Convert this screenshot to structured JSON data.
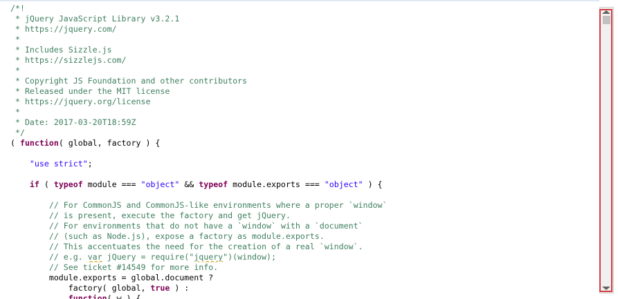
{
  "editor": {
    "lines": [
      [
        {
          "t": "/*!",
          "c": "cm"
        }
      ],
      [
        {
          "t": " * jQuery JavaScript Library v3.2.1",
          "c": "cm"
        }
      ],
      [
        {
          "t": " * https://jquery.com/",
          "c": "cm"
        }
      ],
      [
        {
          "t": " *",
          "c": "cm"
        }
      ],
      [
        {
          "t": " * Includes Sizzle.js",
          "c": "cm"
        }
      ],
      [
        {
          "t": " * https://sizzlejs.com/",
          "c": "cm"
        }
      ],
      [
        {
          "t": " *",
          "c": "cm"
        }
      ],
      [
        {
          "t": " * Copyright JS Foundation and other contributors",
          "c": "cm"
        }
      ],
      [
        {
          "t": " * Released under the MIT license",
          "c": "cm"
        }
      ],
      [
        {
          "t": " * https://jquery.org/license",
          "c": "cm"
        }
      ],
      [
        {
          "t": " *",
          "c": "cm"
        }
      ],
      [
        {
          "t": " * Date: 2017-03-20T18:59Z",
          "c": "cm"
        }
      ],
      [
        {
          "t": " */",
          "c": "cm"
        }
      ],
      [
        {
          "t": "( ",
          "c": "pl"
        },
        {
          "t": "function",
          "c": "kw"
        },
        {
          "t": "( global, factory ) {",
          "c": "pl"
        }
      ],
      [],
      [
        {
          "t": "    ",
          "c": "pl"
        },
        {
          "t": "\"use strict\"",
          "c": "st"
        },
        {
          "t": ";",
          "c": "pl"
        }
      ],
      [],
      [
        {
          "t": "    ",
          "c": "pl"
        },
        {
          "t": "if",
          "c": "kw"
        },
        {
          "t": " ( ",
          "c": "pl"
        },
        {
          "t": "typeof",
          "c": "kw"
        },
        {
          "t": " module === ",
          "c": "pl"
        },
        {
          "t": "\"object\"",
          "c": "st"
        },
        {
          "t": " && ",
          "c": "pl"
        },
        {
          "t": "typeof",
          "c": "kw"
        },
        {
          "t": " module.exports === ",
          "c": "pl"
        },
        {
          "t": "\"object\"",
          "c": "st"
        },
        {
          "t": " ) {",
          "c": "pl"
        }
      ],
      [],
      [
        {
          "t": "        // For CommonJS and CommonJS-like environments where a proper `window`",
          "c": "cm"
        }
      ],
      [
        {
          "t": "        // is present, execute the factory and get jQuery.",
          "c": "cm"
        }
      ],
      [
        {
          "t": "        // For environments that do not have a `window` with a `document`",
          "c": "cm"
        }
      ],
      [
        {
          "t": "        // (such as Node.js), expose a factory as module.exports.",
          "c": "cm"
        }
      ],
      [
        {
          "t": "        // This accentuates the need for the creation of a real `window`.",
          "c": "cm"
        }
      ],
      [
        {
          "t": "        // e.g. ",
          "c": "cm"
        },
        {
          "t": "var",
          "c": "cm sq"
        },
        {
          "t": " jQuery = require(\"",
          "c": "cm"
        },
        {
          "t": "jquery",
          "c": "cm sq"
        },
        {
          "t": "\")(window);",
          "c": "cm"
        }
      ],
      [
        {
          "t": "        // See ticket #14549 for more info.",
          "c": "cm"
        }
      ],
      [
        {
          "t": "        module.exports = global.document ?",
          "c": "pl"
        }
      ],
      [
        {
          "t": "            factory( global, ",
          "c": "pl"
        },
        {
          "t": "true",
          "c": "kw"
        },
        {
          "t": " ) :",
          "c": "pl"
        }
      ],
      [
        {
          "t": "            ",
          "c": "pl"
        },
        {
          "t": "function",
          "c": "kw"
        },
        {
          "t": "( w ) {",
          "c": "pl"
        }
      ]
    ]
  },
  "scrollbar": {
    "up_icon": "arrow-up-icon",
    "down_icon": "arrow-down-icon",
    "highlight_color": "#d33c3c"
  },
  "colors": {
    "comment": "#3f7f5f",
    "keyword": "#7f0055",
    "string": "#2a00ff"
  }
}
